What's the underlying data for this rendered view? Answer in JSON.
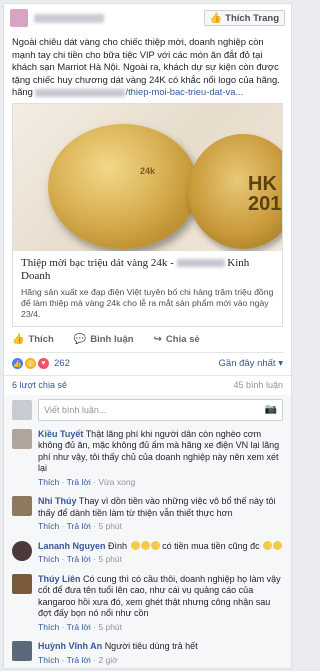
{
  "header": {
    "like_button": "Thích Trang"
  },
  "post": {
    "text_1": "Ngoài chiêu dát vàng cho chiếc thiệp mời, doanh nghiệp còn mạnh tay chi tiền cho bữa tiệc VIP với các món ăn đắt đỏ tại khách sạn Marriot Hà Nội. Ngoài ra, khách dự sự kiện còn được tặng chiếc huy chương dát vàng 24K có khắc nổi logo của hãng.",
    "link_suffix": "/thiep-moi-bac-trieu-dat-va...",
    "link_prefix": "hãng"
  },
  "link_card": {
    "coin_text_1": "24k",
    "coin_text_2": "HK\n201",
    "title_1": "Thiệp mời bạc triệu dát vàng 24k -",
    "title_2": "Kinh Doanh",
    "description": "Hãng sản xuất xe đạp điện Việt tuyên bố chi hàng trăm triệu đồng để làm thiệp mà vàng 24k cho lễ ra mắt sản phẩm mới vào ngày 23/4."
  },
  "actions": {
    "like": "Thích",
    "comment": "Bình luận",
    "share": "Chia sẻ"
  },
  "reactions": {
    "count": "262",
    "sort": "Gần đây nhất"
  },
  "shares": {
    "shares": "6 lượt chia sẻ",
    "comments": "45 bình luận"
  },
  "comment_input": {
    "placeholder": "Viết bình luận..."
  },
  "comments": [
    {
      "name": "Kiều Tuyết",
      "text": "Thật lãng phí khi người dân còn nghèo cơm không đủ ăn, mặc không đủ ấm mà hãng xe điện VN lại lãng phí như vậy, tôi thấy chủ của doanh nghiệp này nên xem xét lại",
      "like": "Thích",
      "reply": "Trả lời",
      "time": "Vừa xong",
      "color": "#b0a59a"
    },
    {
      "name": "Nhi Thúy",
      "text": "Thay vì dồn tiền vào những việc vô bổ thế này tôi thấy để dành tiền làm từ thiện vẫn thiết thực hơn",
      "like": "Thích",
      "reply": "Trả lời",
      "time": "5 phút",
      "color": "#8f7860"
    },
    {
      "name": "Lananh Nguyen",
      "text": "Đình",
      "text_2": "có tiền mua tiền cũng đc",
      "like": "Thích",
      "reply": "Trả lời",
      "time": "5 phút",
      "color": "#4a3a3a"
    },
    {
      "name": "Thúy Liên",
      "text": "Có cung thì có cầu thôi, doanh nghiệp họ làm vậy cốt để đưa tên tuổi lên cao, như cái vụ quảng cáo của kangaroo hồi xưa đó, xem ghét thật nhưng công nhận sau đợt đấy bọn nó nổi như cồn",
      "like": "Thích",
      "reply": "Trả lời",
      "time": "5 phút",
      "color": "#7a5a3a"
    },
    {
      "name": "Huỳnh Vĩnh An",
      "text": "Người tiêu dùng trả hết",
      "like": "Thích",
      "reply": "Trả lời",
      "time": "2 giờ",
      "color": "#5a6a7a"
    }
  ]
}
